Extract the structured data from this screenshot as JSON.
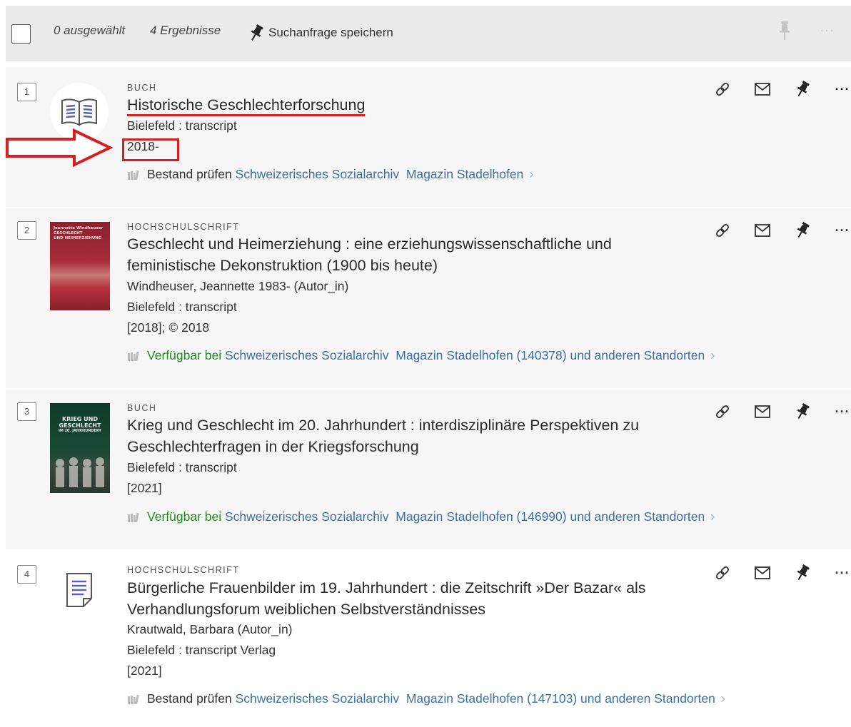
{
  "toolbar": {
    "selected": "0 ausgewählt",
    "count": "4 Ergebnisse",
    "save_query": "Suchanfrage speichern"
  },
  "results": [
    {
      "number": "1",
      "type": "BUCH",
      "title_lines": [
        "Historische Geschlechterforschung"
      ],
      "lines": [
        "Bielefeld : transcript",
        "2018-"
      ],
      "availability": {
        "label": "Bestand prüfen",
        "library": "Schweizerisches Sozialarchiv",
        "location": "Magazin Stadelhofen",
        "suffix": ""
      }
    },
    {
      "number": "2",
      "type": "HOCHSCHULSCHRIFT",
      "title_lines": [
        "Geschlecht und Heimerziehung : eine erziehungswissenschaftliche und",
        "feministische Dekonstruktion (1900 bis heute)"
      ],
      "lines": [
        "Windheuser, Jeannette 1983- (Autor_in)",
        "Bielefeld : transcript",
        "[2018]; © 2018"
      ],
      "availability": {
        "label": "Verfügbar bei",
        "library": "Schweizerisches Sozialarchiv",
        "location": "Magazin Stadelhofen (140378) und anderen Standorten",
        "suffix": ""
      },
      "cover_text": [
        "Jeannette Windheuser",
        "GESCHLECHT",
        "UND HEIMERZIEHUNG"
      ]
    },
    {
      "number": "3",
      "type": "BUCH",
      "title_lines": [
        "Krieg und Geschlecht im 20. Jahrhundert : interdisziplinäre Perspektiven zu",
        "Geschlechterfragen in der Kriegsforschung"
      ],
      "lines": [
        "Bielefeld : transcript",
        "[2021]"
      ],
      "availability": {
        "label": "Verfügbar bei",
        "library": "Schweizerisches Sozialarchiv",
        "location": "Magazin Stadelhofen (146990) und anderen Standorten",
        "suffix": ""
      },
      "cover_text": [
        "KRIEG UND",
        "GESCHLECHT",
        "IM 20. JAHRHUNDERT"
      ]
    },
    {
      "number": "4",
      "type": "HOCHSCHULSCHRIFT",
      "title_lines": [
        "Bürgerliche Frauenbilder im 19. Jahrhundert : die Zeitschrift »Der Bazar« als",
        "Verhandlungsforum weiblichen Selbstverständnisses"
      ],
      "lines": [
        "Krautwald, Barbara (Autor_in)",
        "Bielefeld : transcript Verlag",
        "[2021]"
      ],
      "availability": {
        "label": "Bestand prüfen",
        "library": "Schweizerisches Sozialarchiv",
        "location": "Magazin Stadelhofen (147103) und anderen Standorten",
        "suffix": ""
      }
    }
  ],
  "icons": {
    "link": "link-icon",
    "mail": "mail-icon",
    "pin": "pin-icon",
    "more": "more-icon"
  },
  "colors": {
    "toolbar_bg": "#ebebeb",
    "card_bg": "#f6f6f6",
    "available_green": "#228b22",
    "link_blue": "#3d6fa6",
    "annotation_red": "#d81e1e"
  },
  "actions": {
    "more": "···",
    "chevron": "›"
  }
}
